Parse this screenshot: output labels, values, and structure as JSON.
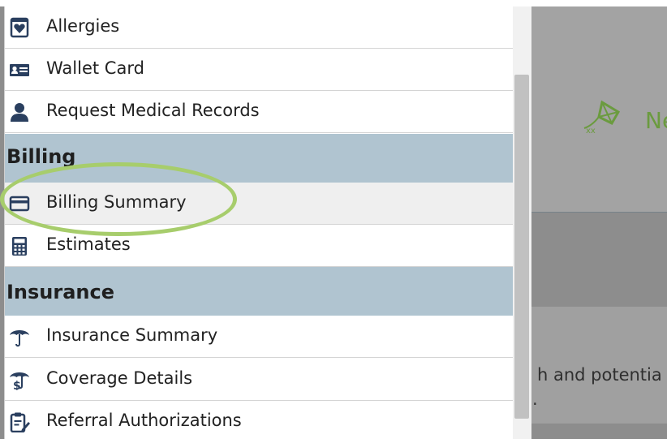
{
  "menu": {
    "items_top": [
      {
        "label": "Allergies",
        "icon": "heart-folder-icon"
      },
      {
        "label": "Wallet Card",
        "icon": "id-card-icon"
      },
      {
        "label": "Request Medical Records",
        "icon": "person-icon"
      }
    ],
    "billing": {
      "header": "Billing",
      "items": [
        {
          "label": "Billing Summary",
          "icon": "credit-card-icon",
          "active": true
        },
        {
          "label": "Estimates",
          "icon": "calculator-icon"
        }
      ]
    },
    "insurance": {
      "header": "Insurance",
      "items": [
        {
          "label": "Insurance Summary",
          "icon": "umbrella-icon"
        },
        {
          "label": "Coverage Details",
          "icon": "umbrella-dollar-icon"
        },
        {
          "label": "Referral Authorizations",
          "icon": "clipboard-pen-icon"
        }
      ]
    }
  },
  "background": {
    "title_fragment": "Ne",
    "text_fragment_1": "h and potentia",
    "text_fragment_2": "."
  },
  "colors": {
    "section_header": "#b0c4d0",
    "highlight": "#a7cd6c",
    "icon": "#2a3f5f",
    "brand_green": "#6b9b3f"
  }
}
